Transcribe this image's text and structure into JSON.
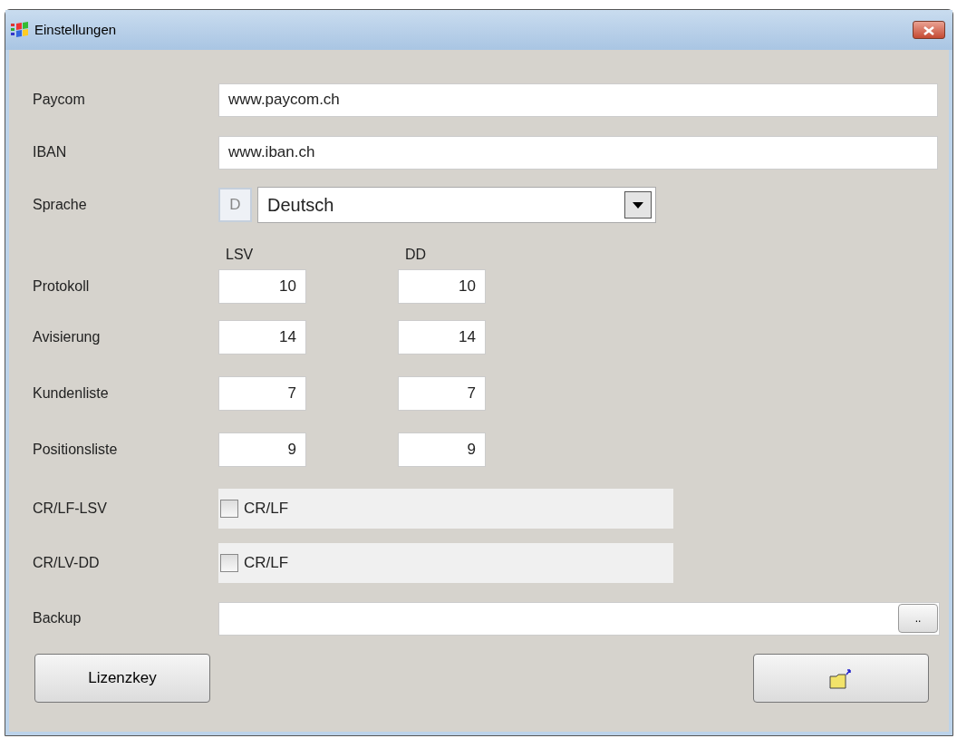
{
  "window": {
    "title": "Einstellungen"
  },
  "fields": [
    {
      "label": "Paycom",
      "value": "www.paycom.ch"
    },
    {
      "label": "IBAN",
      "value": "www.iban.ch"
    }
  ],
  "language": {
    "label": "Sprache",
    "code": "D",
    "value": "Deutsch"
  },
  "counts": {
    "columns": [
      "LSV",
      "DD"
    ],
    "rows": [
      {
        "label": "Protokoll",
        "values": [
          "10",
          "10"
        ]
      },
      {
        "label": "Avisierung",
        "values": [
          "14",
          "14"
        ]
      },
      {
        "label": "Kundenliste",
        "values": [
          "7",
          "7"
        ]
      },
      {
        "label": "Positionsliste",
        "values": [
          "9",
          "9"
        ]
      }
    ]
  },
  "options": [
    {
      "label": "CR/LF-LSV",
      "text": "CR/LF",
      "checked": false
    },
    {
      "label": "CR/LV-DD",
      "text": "CR/LF",
      "checked": false
    }
  ],
  "backup": {
    "label": "Backup",
    "browse": ".."
  },
  "buttons": {
    "license": "Lizenzkey"
  }
}
